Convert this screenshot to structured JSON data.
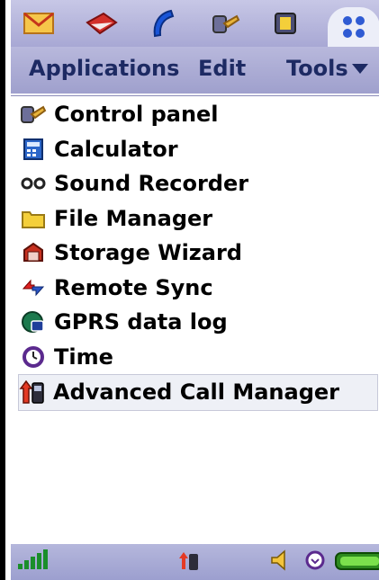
{
  "top_tabs": [
    {
      "icon": "envelope-icon"
    },
    {
      "icon": "contacts-book-icon"
    },
    {
      "icon": "phone-handset-icon"
    },
    {
      "icon": "control-panel-icon"
    },
    {
      "icon": "media-icon"
    },
    {
      "icon": "applications-grid-icon",
      "active": true
    }
  ],
  "menubar": {
    "applications": "Applications",
    "edit": "Edit",
    "tools": "Tools"
  },
  "apps": [
    {
      "label": "Control panel",
      "icon": "control-panel-icon"
    },
    {
      "label": "Calculator",
      "icon": "calculator-icon"
    },
    {
      "label": "Sound Recorder",
      "icon": "sound-recorder-icon"
    },
    {
      "label": "File Manager",
      "icon": "folder-icon"
    },
    {
      "label": "Storage Wizard",
      "icon": "storage-wizard-icon"
    },
    {
      "label": "Remote Sync",
      "icon": "remote-sync-icon"
    },
    {
      "label": "GPRS data log",
      "icon": "gprs-data-log-icon"
    },
    {
      "label": "Time",
      "icon": "clock-icon"
    },
    {
      "label": "Advanced Call Manager",
      "icon": "advanced-call-manager-icon",
      "selected": true
    }
  ],
  "statusbar": {
    "signal": "signal-strength-icon",
    "call": "call-manager-icon",
    "speaker": "speaker-icon",
    "alarm": "alarm-clock-icon",
    "battery": "battery-icon"
  },
  "colors": {
    "menu_text": "#1d2a63",
    "accent": "#a8a8d4",
    "selected_row": "#eef0f6"
  }
}
